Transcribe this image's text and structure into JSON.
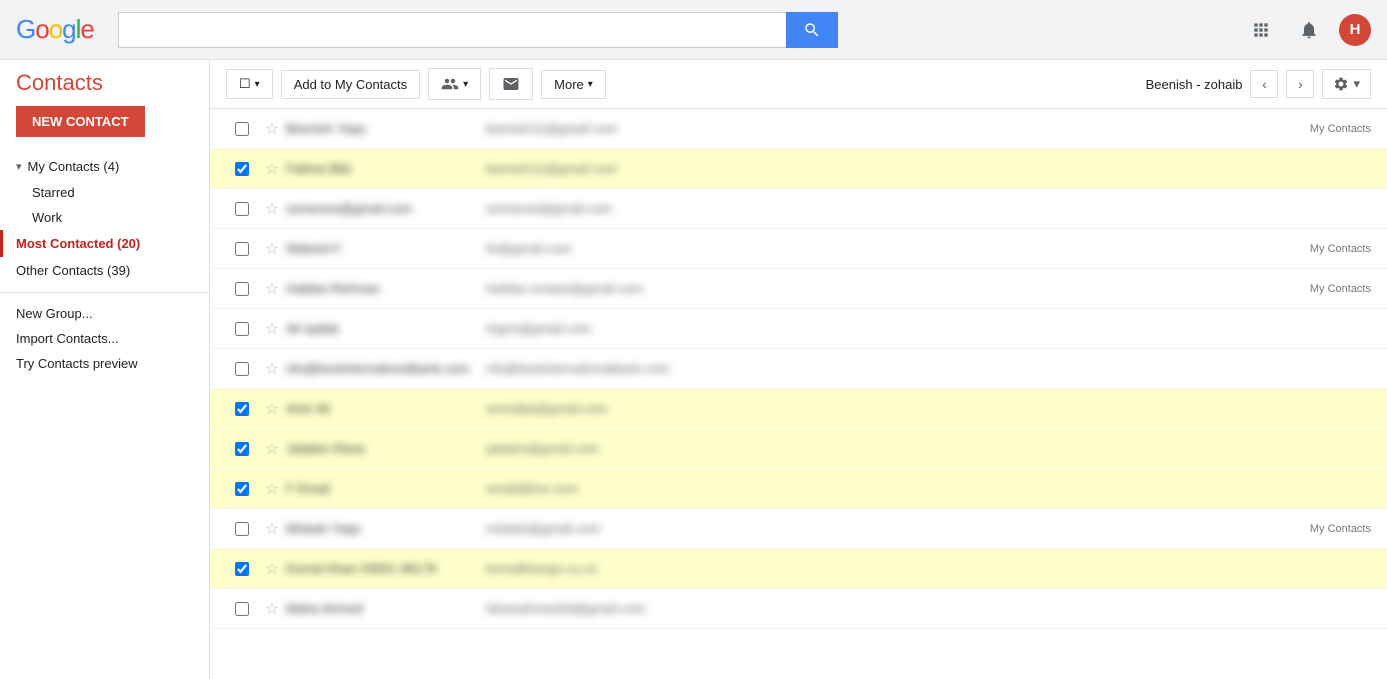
{
  "topbar": {
    "logo": "Google",
    "logo_parts": [
      "G",
      "o",
      "o",
      "g",
      "l",
      "e"
    ],
    "search_placeholder": "",
    "search_btn_label": "Search",
    "apps_icon": "⊞",
    "bell_icon": "🔔",
    "avatar_label": "H"
  },
  "sidebar": {
    "title": "Contacts",
    "new_contact_btn": "NEW CONTACT",
    "items": [
      {
        "label": "My Contacts (4)",
        "active": false,
        "has_arrow": true,
        "id": "my-contacts"
      },
      {
        "label": "Starred",
        "active": false,
        "is_sub": true,
        "id": "starred"
      },
      {
        "label": "Work",
        "active": false,
        "is_sub": true,
        "id": "work"
      },
      {
        "label": "Most Contacted (20)",
        "active": true,
        "id": "most-contacted"
      },
      {
        "label": "Other Contacts (39)",
        "active": false,
        "id": "other-contacts"
      }
    ],
    "links": [
      {
        "label": "New Group...",
        "id": "new-group"
      },
      {
        "label": "Import Contacts...",
        "id": "import-contacts"
      },
      {
        "label": "Try Contacts preview",
        "id": "contacts-preview"
      }
    ]
  },
  "toolbar": {
    "checkbox_dropdown_label": "☐",
    "add_contacts_label": "Add to My Contacts",
    "group_icon_label": "👥",
    "email_icon_label": "✉",
    "more_label": "More",
    "contact_name": "Beenish - zohaib",
    "prev_label": "‹",
    "next_label": "›",
    "settings_label": "⚙"
  },
  "contacts": [
    {
      "id": 1,
      "name": "Beenish Yaqo",
      "email": "beenish11@gmail.com",
      "selected": false,
      "starred": false,
      "tag": "My Contacts"
    },
    {
      "id": 2,
      "name": "Fatima Bibi",
      "email": "beenish11@gmail.com",
      "selected": true,
      "starred": false,
      "tag": ""
    },
    {
      "id": 3,
      "name": "someone@gmail.com",
      "email": "someone@gmail.com",
      "selected": false,
      "starred": false,
      "tag": ""
    },
    {
      "id": 4,
      "name": "Waleed F",
      "email": "fw@gmail.com",
      "selected": false,
      "starred": false,
      "tag": "My Contacts"
    },
    {
      "id": 5,
      "name": "Habiba Rehman",
      "email": "habiba.contact@gmail.com",
      "selected": false,
      "starred": false,
      "tag": "My Contacts"
    },
    {
      "id": 6,
      "name": "Ali Iqallat",
      "email": "trigon@gmail.com",
      "selected": false,
      "starred": false,
      "tag": ""
    },
    {
      "id": 7,
      "name": "nfo@bestinternationalbank.com",
      "email": "nfo@bestinternationalbank.com",
      "selected": false,
      "starred": false,
      "tag": ""
    },
    {
      "id": 8,
      "name": "Amir Ali",
      "email": "amiralipt@gmail.com",
      "selected": true,
      "starred": false,
      "tag": ""
    },
    {
      "id": 9,
      "name": "Jalalein Rana",
      "email": "jalalein@gmail.com",
      "selected": true,
      "starred": false,
      "tag": ""
    },
    {
      "id": 10,
      "name": "F Email",
      "email": "email@live.com",
      "selected": true,
      "starred": false,
      "tag": ""
    },
    {
      "id": 11,
      "name": "Misbah Yaqo",
      "email": "misbah@gmail.com",
      "selected": false,
      "starred": false,
      "tag": "My Contacts"
    },
    {
      "id": 12,
      "name": "Komal Khan 03001 98178",
      "email": "komalkhangn.cu.nz",
      "selected": true,
      "starred": false,
      "tag": ""
    },
    {
      "id": 13,
      "name": "Maha Ahmed",
      "email": "fahanahmed29@gmail.com",
      "selected": false,
      "starred": false,
      "tag": ""
    }
  ]
}
